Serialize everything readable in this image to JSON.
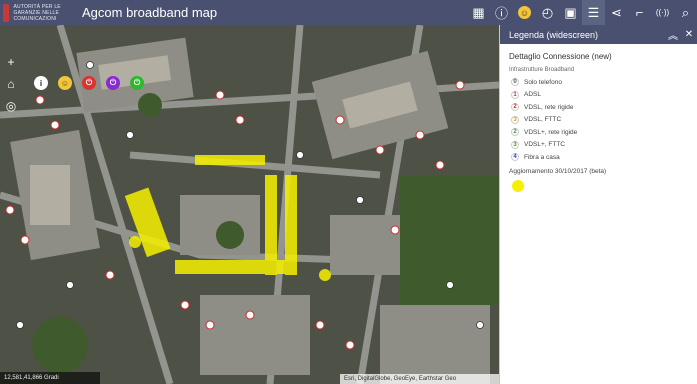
{
  "header": {
    "logo_text": "AUTORITÀ PER LE GARANZIE NELLE COMUNICAZIONI",
    "title": "Agcom broadband map",
    "toolbar": [
      {
        "icon": "grid-icon",
        "glyph": "▦"
      },
      {
        "icon": "info-icon",
        "glyph": "ⓘ"
      },
      {
        "icon": "smile-icon",
        "glyph": "☺"
      },
      {
        "icon": "speed-icon",
        "glyph": "◴"
      },
      {
        "icon": "layers-icon",
        "glyph": "▣"
      },
      {
        "icon": "legend-list-icon",
        "glyph": "☰"
      },
      {
        "icon": "share-icon",
        "glyph": "⋖"
      },
      {
        "icon": "measure-icon",
        "glyph": "⌐"
      },
      {
        "icon": "wireless-icon",
        "glyph": "((·))"
      },
      {
        "icon": "search-icon",
        "glyph": "⌕"
      }
    ]
  },
  "map": {
    "controls": [
      "+",
      "⌂",
      "◎"
    ],
    "float_buttons": [
      {
        "icon": "info-icon",
        "glyph": "i",
        "color": "#ffffff"
      },
      {
        "icon": "smile-icon",
        "glyph": "☺",
        "color": "#f2c53a"
      },
      {
        "icon": "red-power-icon",
        "glyph": "⏻",
        "color": "#d93434"
      },
      {
        "icon": "purple-power-icon",
        "glyph": "⏻",
        "color": "#8a2bd1"
      },
      {
        "icon": "green-power-icon",
        "glyph": "⏻",
        "color": "#2eb82e"
      }
    ],
    "scale_text": "12,581,41,866 Gradi",
    "attribution": "Esri, DigitalGlobe, GeoEye, Earthstar Geo"
  },
  "legend": {
    "panel_title": "Legenda (widescreen)",
    "section_title": "Dettaglio Connessione (new)",
    "subtitle": "Infrastrutture Broadband",
    "items": [
      {
        "num": "0",
        "label": "Solo telefono",
        "color": "#555555"
      },
      {
        "num": "1",
        "label": "ADSL",
        "color": "#d12b2b"
      },
      {
        "num": "2",
        "label": "VDSL, rete rigide",
        "color": "#d12b2b"
      },
      {
        "num": "3",
        "label": "VDSL, FTTC",
        "color": "#e0a000"
      },
      {
        "num": "2",
        "label": "VDSL+, rete rigide",
        "color": "#2e9a2e"
      },
      {
        "num": "3",
        "label": "VDSL+, FTTC",
        "color": "#2e9a2e"
      },
      {
        "num": "4",
        "label": "Fibra a casa",
        "color": "#3a3ad0"
      }
    ],
    "update": "Aggiornamento 30/10/2017 (beta)"
  }
}
